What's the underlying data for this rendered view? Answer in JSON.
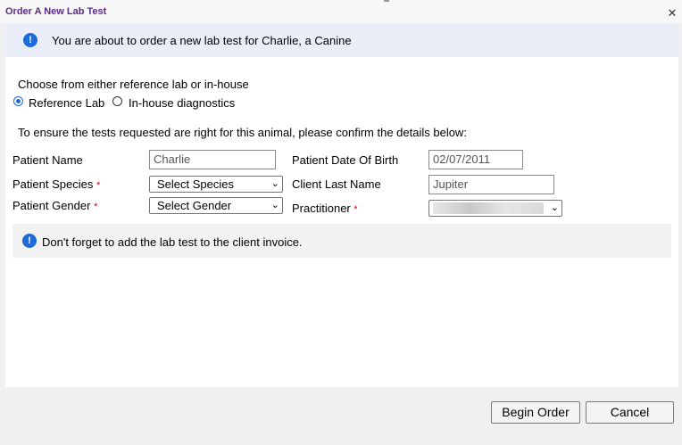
{
  "window": {
    "title": "Order A New Lab Test"
  },
  "banner": {
    "text": "You are about to order a new lab test for Charlie, a Canine"
  },
  "lab_choice": {
    "prompt": "Choose from either reference lab or in-house",
    "options": [
      {
        "label": "Reference Lab",
        "selected": true
      },
      {
        "label": "In-house diagnostics",
        "selected": false
      }
    ]
  },
  "confirm_text": "To ensure the tests requested are right for this animal, please confirm the details below:",
  "form": {
    "patient_name": {
      "label": "Patient Name",
      "value": "Charlie"
    },
    "dob": {
      "label": "Patient Date Of Birth",
      "value": "02/07/2011"
    },
    "species": {
      "label": "Patient Species",
      "required": "*",
      "value": "Select Species"
    },
    "client_last_name": {
      "label": "Client Last Name",
      "value": "Jupiter"
    },
    "gender": {
      "label": "Patient Gender",
      "required": "*",
      "value": "Select Gender"
    },
    "practitioner": {
      "label": "Practitioner",
      "required": "*",
      "value": ""
    }
  },
  "notice": {
    "text": "Don't forget to add the lab test to the client invoice."
  },
  "buttons": {
    "begin": "Begin Order",
    "cancel": "Cancel"
  },
  "icons": {
    "close": "close-icon",
    "info": "info-icon",
    "chevron": "chevron-down-icon"
  },
  "colors": {
    "title": "#5b2a86",
    "accent": "#1e6ad9",
    "required": "#d0021b"
  }
}
